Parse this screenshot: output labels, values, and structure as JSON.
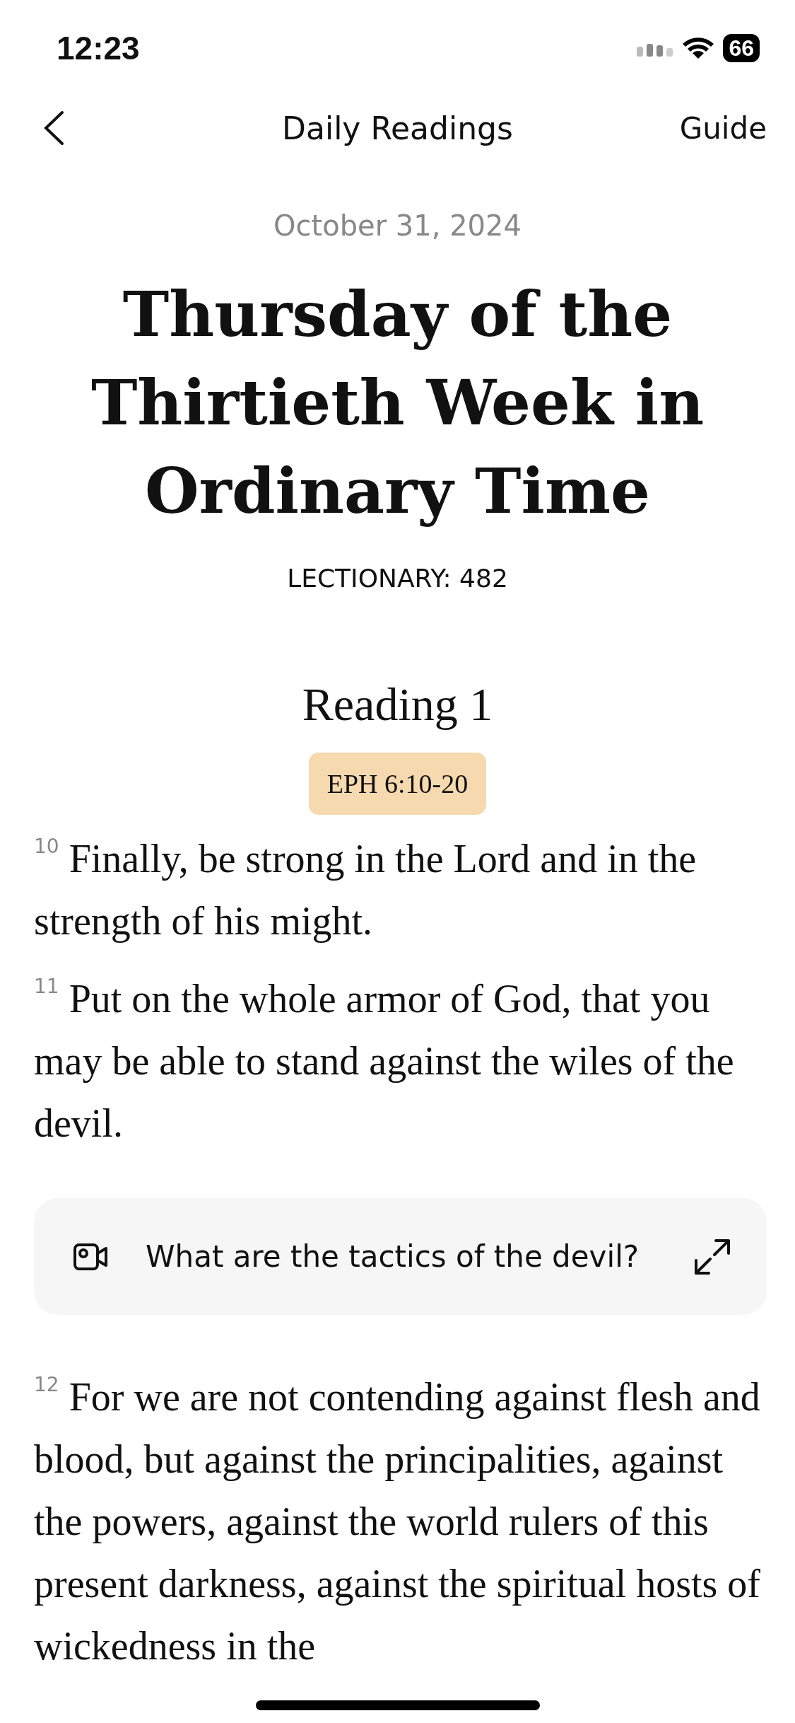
{
  "status_bar": {
    "time": "12:23",
    "battery": "66"
  },
  "nav": {
    "title": "Daily Readings",
    "action": "Guide"
  },
  "date": "October 31, 2024",
  "title": "Thursday of the Thirtieth Week in Ordinary Time",
  "lectionary": "LECTIONARY: 482",
  "reading": {
    "heading": "Reading 1",
    "reference": "EPH 6:10-20",
    "items": [
      {
        "kind": "verse",
        "number": "10",
        "text": "Finally, be strong in the Lord and in the strength of his might."
      },
      {
        "kind": "verse",
        "number": "11",
        "text": "Put on the whole armor of God, that you may be able to stand against the wiles of the devil."
      },
      {
        "kind": "question",
        "text": "What are the tactics of the devil?"
      },
      {
        "kind": "verse",
        "number": "12",
        "text": "For we are not contending against flesh and blood, but against the principalities, against the powers, against the world rulers of this present darkness, against the spiritual hosts of wickedness in the"
      }
    ]
  }
}
